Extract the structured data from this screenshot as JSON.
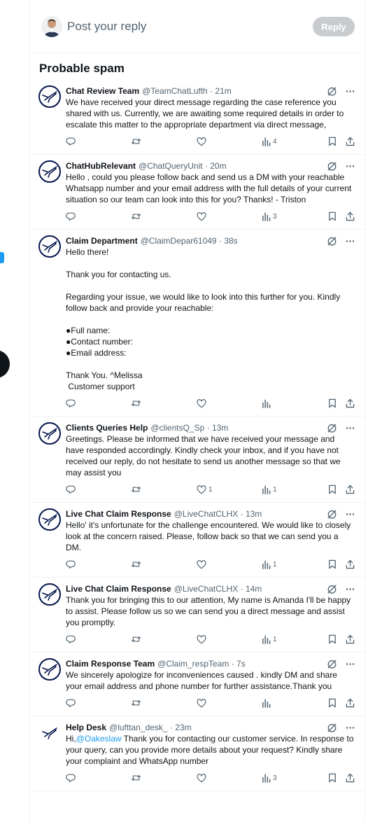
{
  "compose": {
    "placeholder": "Post your reply",
    "reply_label": "Reply"
  },
  "section_title": "Probable spam",
  "colors": {
    "accent": "#1d9bf0",
    "muted": "#536471",
    "reply_disabled": "#c9cccf",
    "avatar_navy": "#05164d"
  },
  "posts": [
    {
      "name": "Chat Review Team",
      "handle": "@TeamChatLufth",
      "time": "21m",
      "text": "We have received your direct message regarding the case reference you shared with us. Currently, we are awaiting some required details in order to escalate this matter to the appropriate department via direct message,",
      "likes": "",
      "views": "4"
    },
    {
      "name": "ChatHubRelevant",
      "handle": "@ChatQueryUnit",
      "time": "20m",
      "text": "Hello , could you please follow back and send us a DM with your reachable Whatsapp number and your email address with the full details of your current situation so our team can look into this for you? Thanks! - Triston",
      "likes": "",
      "views": "3"
    },
    {
      "name": "Claim Department",
      "handle": "@ClaimDepar61049",
      "time": "38s",
      "text": "Hello there!\n\nThank you for contacting us.\n\nRegarding your issue, we would like to look into this further for you. Kindly follow back and provide your reachable:\n\n●Full name:\n●Contact number:\n●Email address:\n\nThank You. ^Melissa\n Customer support",
      "likes": "",
      "views": ""
    },
    {
      "name": "Clients Queries Help",
      "handle": "@clientsQ_Sp",
      "time": "13m",
      "text": "Greetings. Please be informed that we have received your message and have responded accordingly. Kindly check your inbox, and if you have not received our reply, do not hesitate to send us another message so that we may assist you",
      "likes": "1",
      "views": "1"
    },
    {
      "name": "Live Chat Claim Response",
      "handle": "@LiveChatCLHX",
      "time": "13m",
      "text": "Hello' it's unfortunate for the challenge encountered. We would like to closely look at the concern raised. Please, follow back so that we can send you a DM.",
      "likes": "",
      "views": "1"
    },
    {
      "name": "Live Chat Claim Response",
      "handle": "@LiveChatCLHX",
      "time": "14m",
      "text": "Thank you for bringing this to our attention, My name is Amanda I'll be happy to assist. Please follow us so we can send you a direct message and assist you promptly.",
      "likes": "",
      "views": "1"
    },
    {
      "name": "Claim Response Team",
      "handle": "@Claim_respTeam",
      "time": "7s",
      "text": "We sincerely apologize for inconveniences caused . kindly DM and share your email address and phone number for further assistance.Thank you",
      "likes": "",
      "views": ""
    },
    {
      "name": "Help Desk",
      "handle": "@lufttan_desk_",
      "time": "23m",
      "text_before": "Hi,",
      "mention": "@Oakeslaw",
      "text_after": " Thank you for contacting our customer service. In response to your query, can you provide more details about your request? Kindly share your complaint and WhatsApp number",
      "likes": "",
      "views": "3"
    }
  ]
}
